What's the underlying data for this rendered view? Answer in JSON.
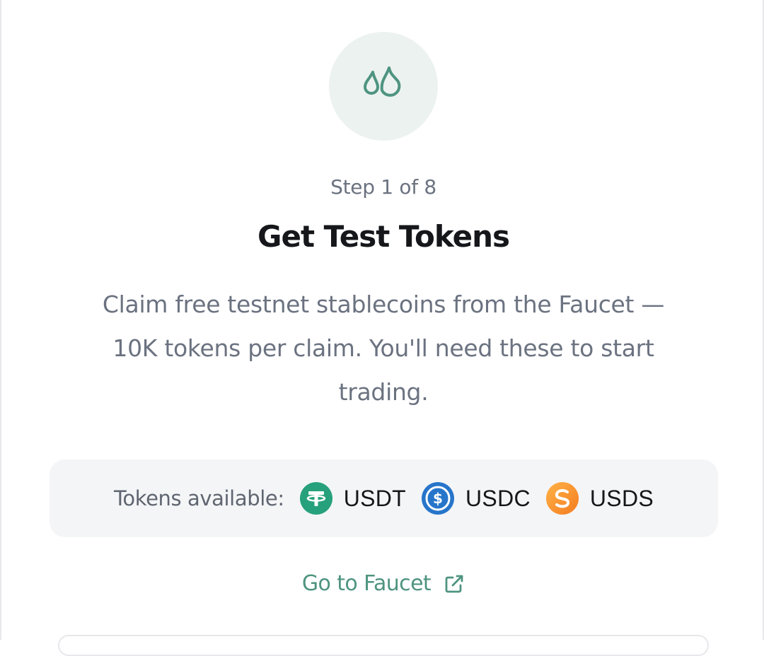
{
  "step_indicator": "Step 1 of 8",
  "title": "Get Test Tokens",
  "description": "Claim free testnet stablecoins from the Faucet — 10K tokens per claim. You'll need these to start trading.",
  "tokens": {
    "label": "Tokens available:",
    "items": [
      {
        "name": "USDT",
        "icon": "usdt-icon",
        "color": "#26a17b"
      },
      {
        "name": "USDC",
        "icon": "usdc-icon",
        "color": "#2775ca"
      },
      {
        "name": "USDS",
        "icon": "usds-icon",
        "color": "#f7931a"
      }
    ]
  },
  "link": {
    "label": "Go to Faucet",
    "icon": "external-link-icon"
  },
  "colors": {
    "accent": "#4e9480",
    "icon_bg": "#ecf2f0",
    "title": "#15171a",
    "muted": "#6b7280",
    "panel": "#f4f5f7"
  },
  "header_icon": "droplets-icon"
}
